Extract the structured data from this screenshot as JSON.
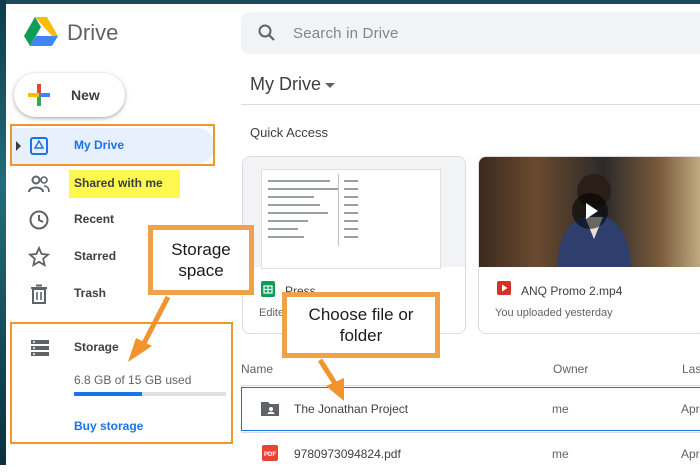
{
  "header": {
    "brand": "Drive",
    "search_placeholder": "Search in Drive"
  },
  "sidebar": {
    "new_label": "New",
    "items": [
      {
        "label": "My Drive",
        "icon": "my-drive-icon",
        "active": true
      },
      {
        "label": "Shared with me",
        "icon": "shared-icon"
      },
      {
        "label": "Recent",
        "icon": "clock-icon"
      },
      {
        "label": "Starred",
        "icon": "star-icon"
      },
      {
        "label": "Trash",
        "icon": "trash-icon"
      }
    ],
    "storage": {
      "label": "Storage",
      "used_text": "6.8 GB of 15 GB used",
      "used_fraction": 0.45,
      "buy_label": "Buy storage"
    }
  },
  "main": {
    "title": "My Drive",
    "quick_access_label": "Quick Access",
    "cards": [
      {
        "name": "Press",
        "sub": "Edite",
        "icon": "sheets-icon"
      },
      {
        "name": "ANQ Promo 2.mp4",
        "sub": "You uploaded yesterday",
        "icon": "video-file-icon"
      }
    ],
    "columns": {
      "name": "Name",
      "owner": "Owner",
      "modified": "Las"
    },
    "files": [
      {
        "name": "The Jonathan Project",
        "owner": "me",
        "modified": "Apr",
        "icon": "shared-folder-icon"
      },
      {
        "name": "9780973094824.pdf",
        "owner": "me",
        "modified": "Apr",
        "icon": "pdf-icon"
      }
    ]
  },
  "annotations": {
    "storage_callout": "Storage space",
    "choose_callout": "Choose file or folder"
  },
  "colors": {
    "accent_blue": "#1a73e8",
    "annotation_orange": "#f2942d",
    "highlight_yellow": "#fff94f"
  }
}
